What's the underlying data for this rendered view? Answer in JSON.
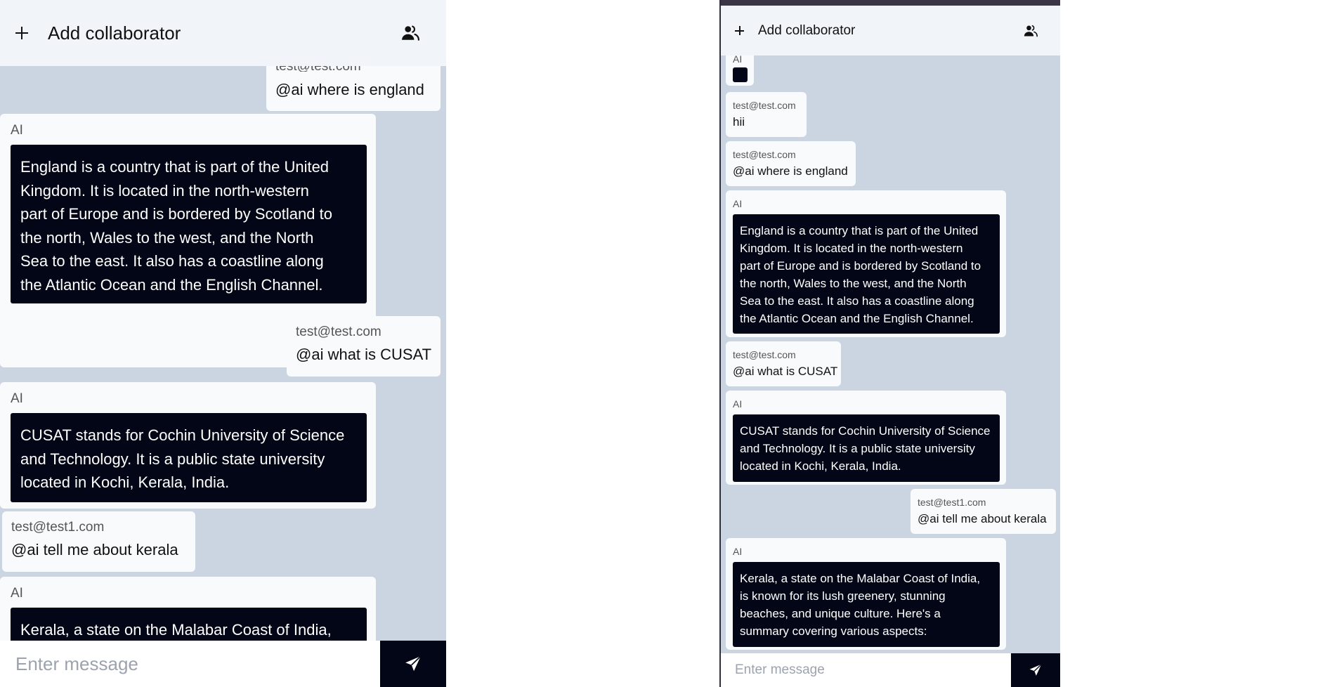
{
  "header": {
    "add_label": "Add collaborator"
  },
  "input": {
    "placeholder": "Enter message"
  },
  "left_messages": [
    {
      "sender": "test@test.com",
      "text": "@ai where is england"
    },
    {
      "sender": "AI",
      "lines": [
        "England is a country that is part of the United",
        "Kingdom. It is located in the north-western",
        "part of Europe and is bordered by Scotland to",
        "the north, Wales to the west, and the North",
        "Sea to the east. It also has a coastline along",
        "the Atlantic Ocean and the English Channel."
      ]
    },
    {
      "sender": "test@test.com",
      "text": "@ai what is CUSAT"
    },
    {
      "sender": "AI",
      "lines": [
        "CUSAT stands for Cochin University of Science",
        "and Technology. It is a public state university",
        "located in Kochi, Kerala, India."
      ]
    },
    {
      "sender": "test@test1.com",
      "text": "@ai tell me about kerala"
    },
    {
      "sender": "AI",
      "lines": [
        "Kerala, a state on the Malabar Coast of India,"
      ]
    }
  ],
  "right_messages": [
    {
      "sender": "AI"
    },
    {
      "sender": "test@test.com",
      "text": "hii"
    },
    {
      "sender": "test@test.com",
      "text": "@ai where is england"
    },
    {
      "sender": "AI",
      "lines": [
        "England is a country that is part of the United",
        "Kingdom. It is located in the north-western",
        "part of Europe and is bordered by Scotland to",
        "the north, Wales to the west, and the North",
        "Sea to the east. It also has a coastline along",
        "the Atlantic Ocean and the English Channel."
      ]
    },
    {
      "sender": "test@test.com",
      "text": "@ai what is CUSAT"
    },
    {
      "sender": "AI",
      "lines": [
        "CUSAT stands for Cochin University of Science",
        "and Technology. It is a public state university",
        "located in Kochi, Kerala, India."
      ]
    },
    {
      "sender": "test@test1.com",
      "text": "@ai tell me about kerala"
    },
    {
      "sender": "AI",
      "lines": [
        "Kerala, a state on the Malabar Coast of India,",
        "is known for its lush greenery, stunning",
        "beaches, and unique culture. Here's a",
        "summary covering various aspects:"
      ]
    }
  ],
  "colors": {
    "panel_bg": "#cbd5e1",
    "header_bg": "#f1f5f9",
    "bubble_bg": "#f8fafc",
    "ai_box_bg": "#020617",
    "send_button_bg": "#020617"
  },
  "icons": [
    "plus-icon",
    "users-icon",
    "send-icon"
  ]
}
